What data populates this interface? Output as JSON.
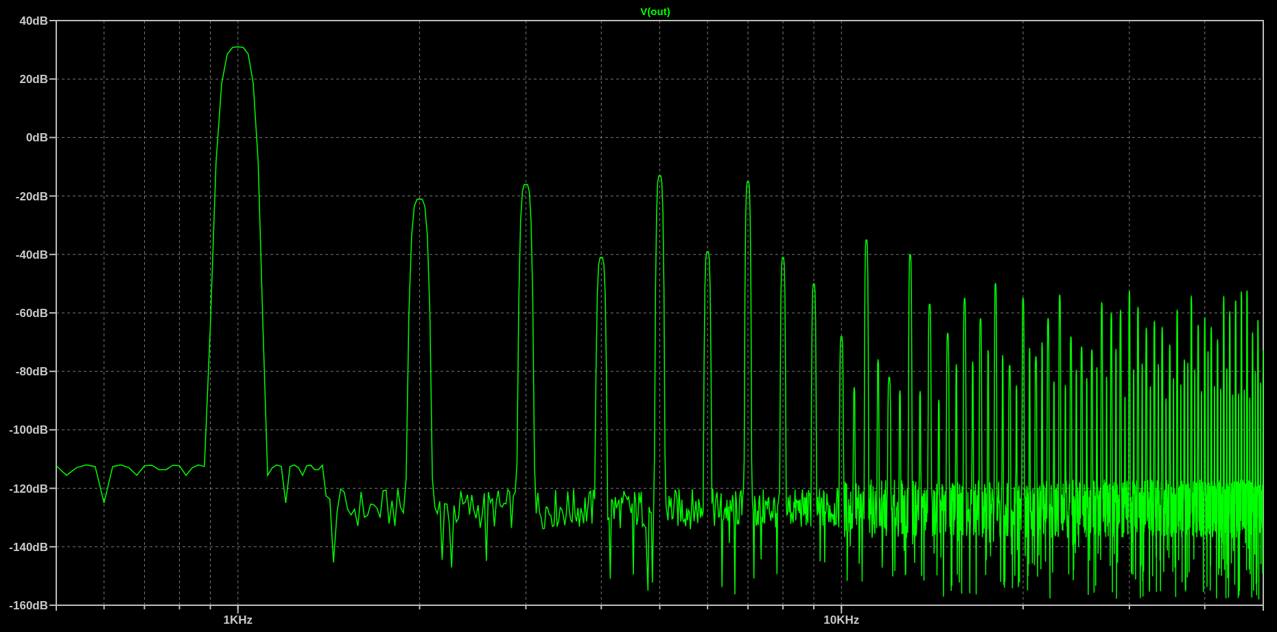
{
  "plot": {
    "trace_title": "V(out)",
    "y_axis_labels": [
      "40dB",
      "20dB",
      "0dB",
      "-20dB",
      "-40dB",
      "-60dB",
      "-80dB",
      "-100dB",
      "-120dB",
      "-140dB",
      "-160dB"
    ],
    "x_axis_labels": [
      "1KHz",
      "10KHz"
    ]
  }
}
